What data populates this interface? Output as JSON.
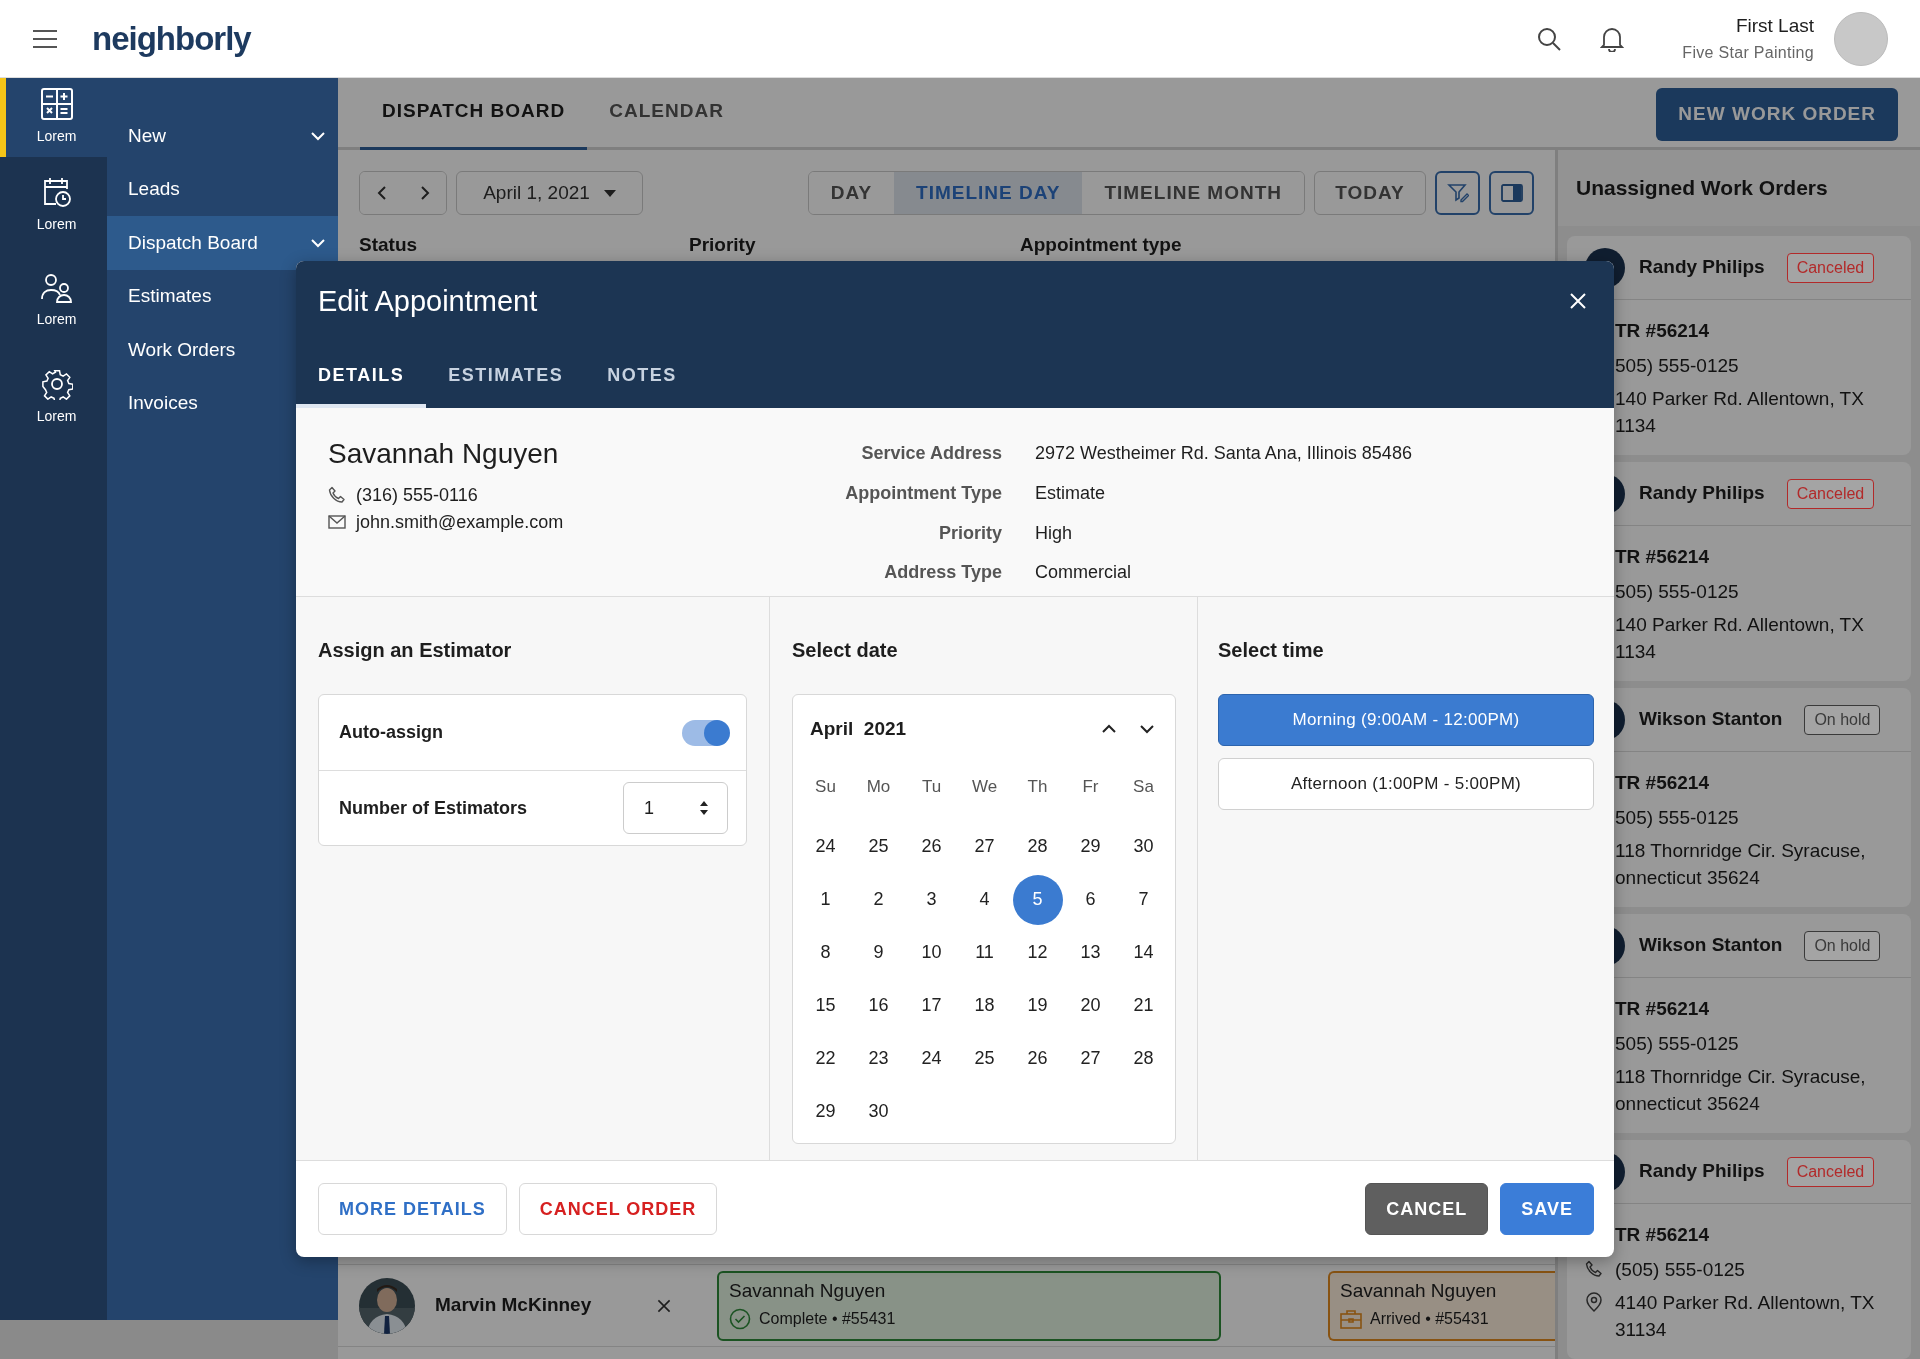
{
  "header": {
    "logo": "neighborly",
    "user_name": "First Last",
    "company": "Five Star Painting"
  },
  "rail": [
    {
      "label": "Lorem",
      "selected": true
    },
    {
      "label": "Lorem",
      "selected": false
    },
    {
      "label": "Lorem",
      "selected": false
    },
    {
      "label": "Lorem",
      "selected": false
    }
  ],
  "subnav": [
    {
      "label": "New",
      "has_submenu": true,
      "selected": false
    },
    {
      "label": "Leads",
      "selected": false
    },
    {
      "label": "Dispatch Board",
      "has_submenu": true,
      "selected": true
    },
    {
      "label": "Estimates",
      "selected": false
    },
    {
      "label": "Work Orders",
      "selected": false
    },
    {
      "label": "Invoices",
      "selected": false
    }
  ],
  "page_tabs": [
    {
      "label": "DISPATCH BOARD",
      "selected": true
    },
    {
      "label": "CALENDAR",
      "selected": false
    }
  ],
  "new_button": "NEW WORK ORDER",
  "toolbar": {
    "date": "April 1, 2021",
    "views": [
      {
        "label": "DAY",
        "selected": false
      },
      {
        "label": "TIMELINE DAY",
        "selected": true
      },
      {
        "label": "TIMELINE MONTH",
        "selected": false
      }
    ],
    "today": "TODAY"
  },
  "board": {
    "columns": [
      "Status",
      "Priority",
      "Appointment type"
    ],
    "rows": [
      {
        "name": "Marvin McKinney",
        "appointments": [
          {
            "customer": "Savannah Nguyen",
            "detail": "Complete • #55431",
            "kind": "complete"
          },
          {
            "customer": "Savannah Nguyen",
            "detail": "Arrived • #55431",
            "kind": "arrived"
          }
        ]
      }
    ]
  },
  "unassigned": {
    "title": "Unassigned Work Orders",
    "orders": [
      {
        "name": "Randy Philips",
        "status": "Canceled",
        "color": "#b22a2a",
        "title": "TR #56214",
        "phone": "505) 555-0125",
        "address_lines": [
          "140 Parker Rd. Allentown, TX",
          "1134"
        ]
      },
      {
        "name": "Randy Philips",
        "status": "Canceled",
        "color": "#b22a2a",
        "title": "TR #56214",
        "phone": "505) 555-0125",
        "address_lines": [
          "140 Parker Rd. Allentown, TX",
          "1134"
        ]
      },
      {
        "name": "Wikson Stanton",
        "status": "On hold",
        "color": "#3a3a3a",
        "title": "TR #56214",
        "phone": "505) 555-0125",
        "address_lines": [
          "118 Thornridge Cir. Syracuse,",
          "onnecticut 35624"
        ]
      },
      {
        "name": "Wikson Stanton",
        "status": "On hold",
        "color": "#3a3a3a",
        "title": "TR #56214",
        "phone": "505) 555-0125",
        "address_lines": [
          "118 Thornridge Cir. Syracuse,",
          "onnecticut 35624"
        ]
      },
      {
        "name": "Randy Philips",
        "status": "Canceled",
        "color": "#b22a2a",
        "title": "TR #56214",
        "phone": "(505) 555-0125",
        "address_lines": [
          "4140 Parker Rd. Allentown, TX",
          "31134"
        ]
      }
    ]
  },
  "modal": {
    "title": "Edit Appointment",
    "tabs": [
      {
        "label": "DETAILS",
        "selected": true
      },
      {
        "label": "ESTIMATES",
        "selected": false
      },
      {
        "label": "NOTES",
        "selected": false
      }
    ],
    "customer": {
      "name": "Savannah Nguyen",
      "phone": "(316) 555-0116",
      "email": "john.smith@example.com"
    },
    "details": [
      {
        "label": "Service Address",
        "value": "2972 Westheimer Rd. Santa Ana, Illinois 85486"
      },
      {
        "label": "Appointment Type",
        "value": "Estimate"
      },
      {
        "label": "Priority",
        "value": "High"
      },
      {
        "label": "Address Type",
        "value": "Commercial"
      }
    ],
    "estimator": {
      "title": "Assign an Estimator",
      "auto_assign_label": "Auto-assign",
      "auto_assign_on": true,
      "count_label": "Number of Estimators",
      "count": "1"
    },
    "date": {
      "title": "Select date",
      "month": "April  2021",
      "weekdays": [
        "Su",
        "Mo",
        "Tu",
        "We",
        "Th",
        "Fr",
        "Sa"
      ],
      "days": [
        {
          "label": "24",
          "selected": false
        },
        {
          "label": "25",
          "selected": false
        },
        {
          "label": "26",
          "selected": false
        },
        {
          "label": "27",
          "selected": false
        },
        {
          "label": "28",
          "selected": false
        },
        {
          "label": "29",
          "selected": false
        },
        {
          "label": "30",
          "selected": false
        },
        {
          "label": "1",
          "selected": false
        },
        {
          "label": "2",
          "selected": false
        },
        {
          "label": "3",
          "selected": false
        },
        {
          "label": "4",
          "selected": false
        },
        {
          "label": "5",
          "selected": true
        },
        {
          "label": "6",
          "selected": false
        },
        {
          "label": "7",
          "selected": false
        },
        {
          "label": "8",
          "selected": false
        },
        {
          "label": "9",
          "selected": false
        },
        {
          "label": "10",
          "selected": false
        },
        {
          "label": "11",
          "selected": false
        },
        {
          "label": "12",
          "selected": false
        },
        {
          "label": "13",
          "selected": false
        },
        {
          "label": "14",
          "selected": false
        },
        {
          "label": "15",
          "selected": false
        },
        {
          "label": "16",
          "selected": false
        },
        {
          "label": "17",
          "selected": false
        },
        {
          "label": "18",
          "selected": false
        },
        {
          "label": "19",
          "selected": false
        },
        {
          "label": "20",
          "selected": false
        },
        {
          "label": "21",
          "selected": false
        },
        {
          "label": "22",
          "selected": false
        },
        {
          "label": "23",
          "selected": false
        },
        {
          "label": "24",
          "selected": false
        },
        {
          "label": "25",
          "selected": false
        },
        {
          "label": "26",
          "selected": false
        },
        {
          "label": "27",
          "selected": false
        },
        {
          "label": "28",
          "selected": false
        },
        {
          "label": "29",
          "selected": false
        },
        {
          "label": "30",
          "selected": false
        }
      ]
    },
    "time": {
      "title": "Select time",
      "slots": [
        {
          "label": "Morning (9:00AM - 12:00PM)",
          "selected": true
        },
        {
          "label": "Afternoon (1:00PM - 5:00PM)",
          "selected": false
        }
      ]
    },
    "footer": {
      "more_details": "MORE DETAILS",
      "cancel_order": "CANCEL ORDER",
      "cancel": "CANCEL",
      "save": "SAVE"
    }
  }
}
